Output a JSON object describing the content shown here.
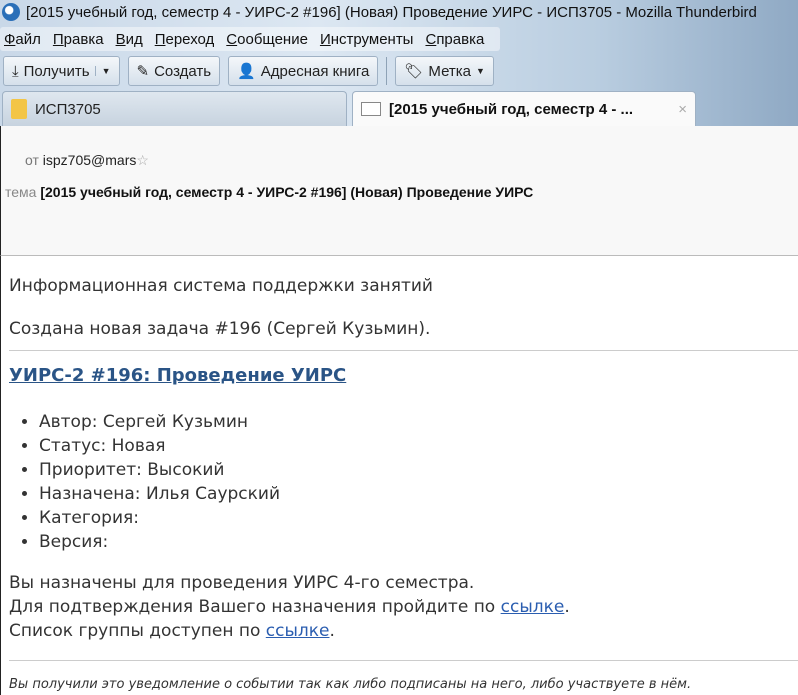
{
  "window": {
    "title": "[2015 учебный год, семестр 4 - УИРС-2 #196] (Новая) Проведение УИРС - ИСП3705 - Mozilla Thunderbird"
  },
  "menu": [
    "Файл",
    "Правка",
    "Вид",
    "Переход",
    "Сообщение",
    "Инструменты",
    "Справка"
  ],
  "toolbar": {
    "get": "Получить",
    "write": "Создать",
    "address_book": "Адресная книга",
    "tag": "Метка"
  },
  "tabs": [
    {
      "label": "ИСП3705"
    },
    {
      "label": "[2015 учебный год, семестр 4 - ..."
    }
  ],
  "message": {
    "from_label": "от",
    "from": "ispz705@mars",
    "subject_label": "тема",
    "subject": "[2015 учебный год, семестр 4 - УИРС-2 #196] (Новая) Проведение УИРС"
  },
  "body": {
    "intro": "Информационная система поддержки занятий",
    "created": "Создана новая задача #196 (Сергей Кузьмин).",
    "issue_link": "УИРС-2 #196: Проведение УИРС",
    "fields": [
      "Автор: Сергей Кузьмин",
      "Статус: Новая",
      "Приоритет: Высокий",
      "Назначена: Илья Саурский",
      "Категория:",
      "Версия:"
    ],
    "line1": "Вы назначены для проведения УИРС 4-го семестра.",
    "line2": "Для подтверждения Вашего назначения пройдите по ",
    "link": "ссылке",
    "line3": "Список группы доступен по ",
    "dot": ".",
    "footer": "Вы получили это уведомление о событии так как либо подписаны на него, либо участвуете в нём."
  }
}
